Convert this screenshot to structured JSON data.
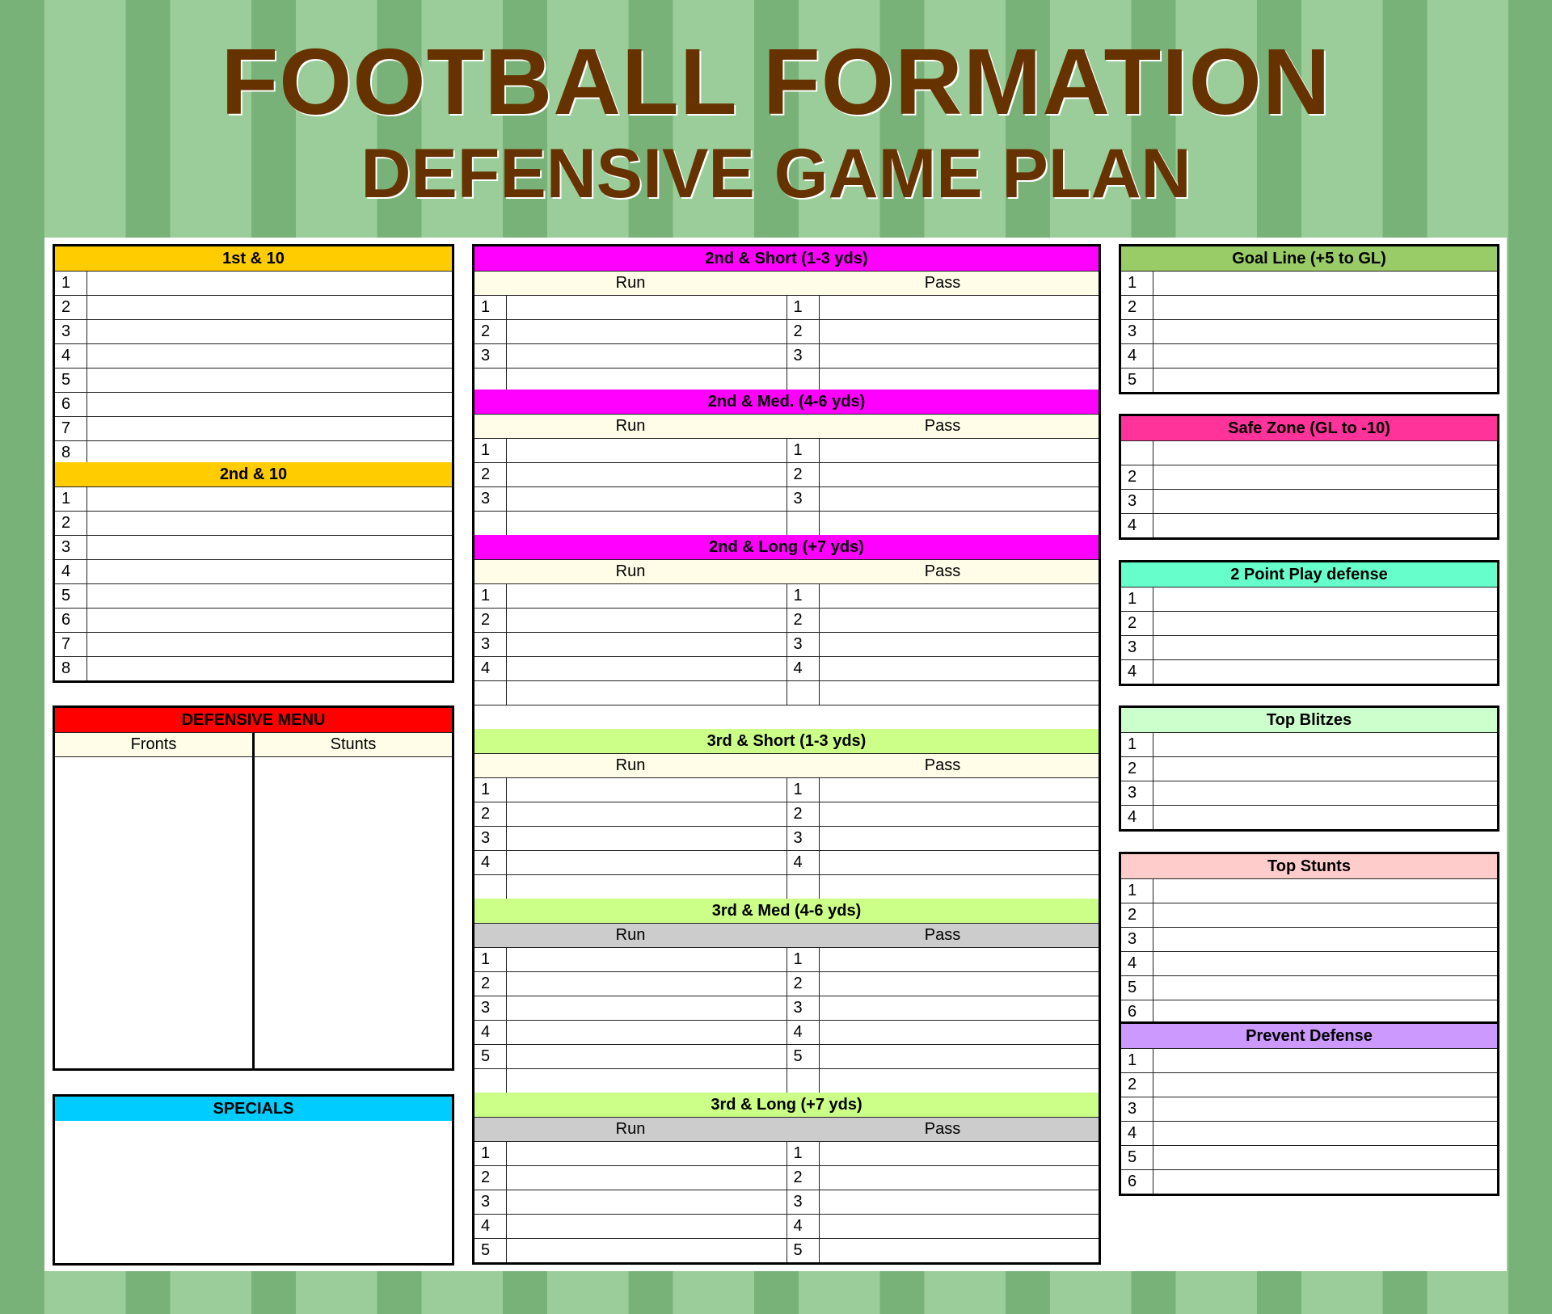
{
  "title": "FOOTBALL FORMATION",
  "subtitle": "DEFENSIVE GAME PLAN",
  "sections": {
    "first_10": {
      "title": "1st & 10",
      "color": "#FFCC00",
      "rows": [
        "1",
        "2",
        "3",
        "4",
        "5",
        "6",
        "7",
        "8"
      ]
    },
    "second_10": {
      "title": "2nd & 10",
      "color": "#FFCC00",
      "rows": [
        "1",
        "2",
        "3",
        "4",
        "5",
        "6",
        "7",
        "8"
      ]
    },
    "defensive_menu": {
      "title": "DEFENSIVE MENU",
      "color": "#FF0000",
      "columns": [
        "Fronts",
        "Stunts"
      ]
    },
    "specials": {
      "title": "SPECIALS",
      "color": "#00CCFF"
    },
    "second_short": {
      "title": "2nd & Short (1-3 yds)",
      "color": "#FF00FF",
      "sub_color": "#FFFDE8",
      "run_label": "Run",
      "pass_label": "Pass",
      "rows": [
        "1",
        "2",
        "3",
        ""
      ]
    },
    "second_med": {
      "title": "2nd & Med. (4-6 yds)",
      "color": "#FF00FF",
      "sub_color": "#FFFDE8",
      "run_label": "Run",
      "pass_label": "Pass",
      "rows": [
        "1",
        "2",
        "3",
        ""
      ]
    },
    "second_long": {
      "title": "2nd & Long (+7 yds)",
      "color": "#FF00FF",
      "sub_color": "#FFFDE8",
      "run_label": "Run",
      "pass_label": "Pass",
      "rows": [
        "1",
        "2",
        "3",
        "4",
        ""
      ],
      "extra_full_row": true
    },
    "third_short": {
      "title": "3rd & Short (1-3 yds)",
      "color": "#CCFF88",
      "sub_color": "#FFFDE8",
      "run_label": "Run",
      "pass_label": "Pass",
      "rows": [
        "1",
        "2",
        "3",
        "4",
        ""
      ]
    },
    "third_med": {
      "title": "3rd & Med (4-6 yds)",
      "color": "#CCFF88",
      "sub_color": "#CCCCCC",
      "run_label": "Run",
      "pass_label": "Pass",
      "rows": [
        "1",
        "2",
        "3",
        "4",
        "5",
        ""
      ]
    },
    "third_long": {
      "title": "3rd & Long (+7 yds)",
      "color": "#CCFF88",
      "sub_color": "#CCCCCC",
      "run_label": "Run",
      "pass_label": "Pass",
      "rows": [
        "1",
        "2",
        "3",
        "4",
        "5"
      ]
    },
    "goal_line": {
      "title": "Goal Line (+5 to GL)",
      "color": "#99CC66",
      "rows": [
        "1",
        "2",
        "3",
        "4",
        "5"
      ]
    },
    "safe_zone": {
      "title": "Safe Zone (GL to -10)",
      "color": "#FF3399",
      "rows": [
        "",
        "2",
        "3",
        "4"
      ]
    },
    "two_point": {
      "title": "2 Point Play defense",
      "color": "#66FFCC",
      "rows": [
        "1",
        "2",
        "3",
        "4"
      ]
    },
    "top_blitzes": {
      "title": "Top Blitzes",
      "color": "#CCFFCC",
      "rows": [
        "1",
        "2",
        "3",
        "4"
      ]
    },
    "top_stunts": {
      "title": "Top Stunts",
      "color": "#FFCCCC",
      "rows": [
        "1",
        "2",
        "3",
        "4",
        "5",
        "6"
      ]
    },
    "prevent": {
      "title": "Prevent Defense",
      "color": "#CC99FF",
      "rows": [
        "1",
        "2",
        "3",
        "4",
        "5",
        "6"
      ]
    }
  }
}
